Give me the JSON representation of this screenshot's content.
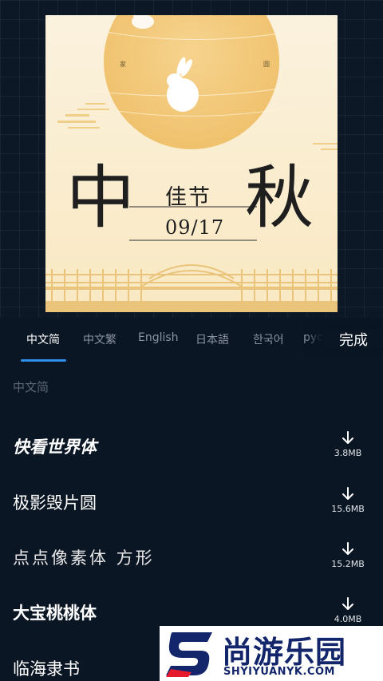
{
  "poster": {
    "big_left": "中",
    "big_right": "秋",
    "subtitle": "佳节",
    "date": "09/17",
    "small_left": "家",
    "small_right": "圆"
  },
  "tabs": {
    "items": [
      "中文简",
      "中文繁",
      "English",
      "日本語",
      "한국어",
      "русский"
    ],
    "active_index": 0,
    "done_label": "完成"
  },
  "section_label": "中文简",
  "fonts": [
    {
      "name": "快看世界体",
      "size": "3.8MB"
    },
    {
      "name": "极影毁片圆",
      "size": "15.6MB"
    },
    {
      "name": "点点像素体 方形",
      "size": "15.2MB"
    },
    {
      "name": "大宝桃桃体",
      "size": "4.0MB"
    },
    {
      "name": "临海隶书",
      "size": ""
    }
  ],
  "watermark": {
    "title": "尚游乐园",
    "url": "SHYIYUANYK.COM"
  },
  "colors": {
    "background": "#0b1624",
    "accent": "#2f8ee8",
    "poster_bg": "#fbeed0",
    "moon": "#f2c777"
  }
}
